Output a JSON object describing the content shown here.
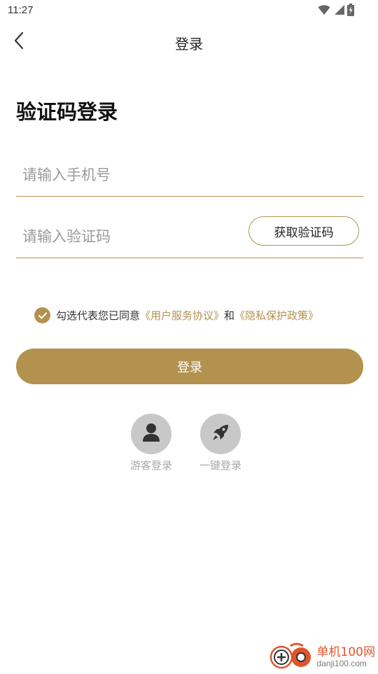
{
  "status_bar": {
    "time": "11:27",
    "icons": [
      "wifi-icon",
      "signal-icon",
      "battery-charging-icon"
    ]
  },
  "nav": {
    "title": "登录",
    "back_icon": "chevron-left-icon"
  },
  "page_title": "验证码登录",
  "phone_input": {
    "placeholder": "请输入手机号",
    "value": ""
  },
  "code_input": {
    "placeholder": "请输入验证码",
    "value": ""
  },
  "get_code_button": "获取验证码",
  "agreement": {
    "checked": true,
    "prefix": "勾选代表您已同意",
    "user_agreement": "《用户服务协议》",
    "conjunction": "和",
    "privacy_policy": "《隐私保护政策》"
  },
  "login_button": "登录",
  "alt_logins": [
    {
      "label": "游客登录",
      "icon": "person-icon"
    },
    {
      "label": "一键登录",
      "icon": "rocket-icon"
    }
  ],
  "watermark": {
    "title": "单机100网",
    "url": "danji100.com"
  },
  "colors": {
    "accent": "#b3924f",
    "icon_bg": "#c8c8c8",
    "watermark": "#e0552b"
  }
}
